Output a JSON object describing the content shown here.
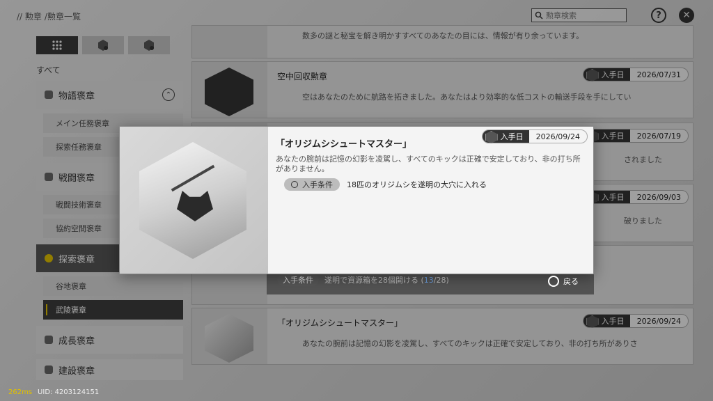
{
  "breadcrumb": {
    "part1": "// 勲章",
    "part2": "/勲章一覧"
  },
  "search": {
    "placeholder": "勲章検索"
  },
  "header": {
    "help": "?",
    "close": "✕"
  },
  "sidebar": {
    "all_label": "すべて",
    "categories": [
      {
        "label": "物語褒章"
      },
      {
        "label": "戦闘褒章"
      },
      {
        "label": "探索褒章"
      },
      {
        "label": "成長褒章"
      },
      {
        "label": "建設褒章"
      }
    ],
    "subs": [
      {
        "label": "メイン任務褒章"
      },
      {
        "label": "探索任務褒章"
      },
      {
        "label": "戦闘技術褒章"
      },
      {
        "label": "協約空間褒章"
      },
      {
        "label": "谷地褒章"
      },
      {
        "label": "武陵褒章"
      }
    ]
  },
  "list": {
    "top_desc": "数多の謎と秘宝を解き明かすすべてのあなたの目には、情報が有り余っています。",
    "cards": [
      {
        "title": "空中回収勲章",
        "desc": "空はあなたのために航路を拓きました。あなたはより効率的な低コストの輸送手段を手にしてい",
        "date_label": "入手日",
        "date": "2026/07/31"
      },
      {
        "date_label": "入手日",
        "date": "2026/07/19",
        "desc_tail": "されました"
      },
      {
        "date_label": "入手日",
        "date": "2026/09/03",
        "desc_tail": "破りました"
      },
      {
        "title": "「オリジムシシュートマスター」",
        "desc": "あなたの腕前は記憶の幻影を凌駕し、すべてのキックは正確で安定しており、非の打ち所がありさ",
        "date_label": "入手日",
        "date": "2026/09/24"
      }
    ],
    "behind_cond": {
      "pill": "入手条件",
      "text": "遂明で資源箱を28個開ける (",
      "progress": "13",
      "total": "/28)"
    }
  },
  "modal": {
    "title": "「オリジムシシュートマスター」",
    "desc": "あなたの腕前は記憶の幻影を凌駕し、すべてのキックは正確で安定しており、非の打ち所がありません。",
    "date_label": "入手日",
    "date": "2026/09/24",
    "cond_label": "入手条件",
    "cond_text": "18匹のオリジムシを遂明の大穴に入れる",
    "back_label": "戻る"
  },
  "footer": {
    "ping": "262ms",
    "uid": "UID: 4203124151"
  }
}
